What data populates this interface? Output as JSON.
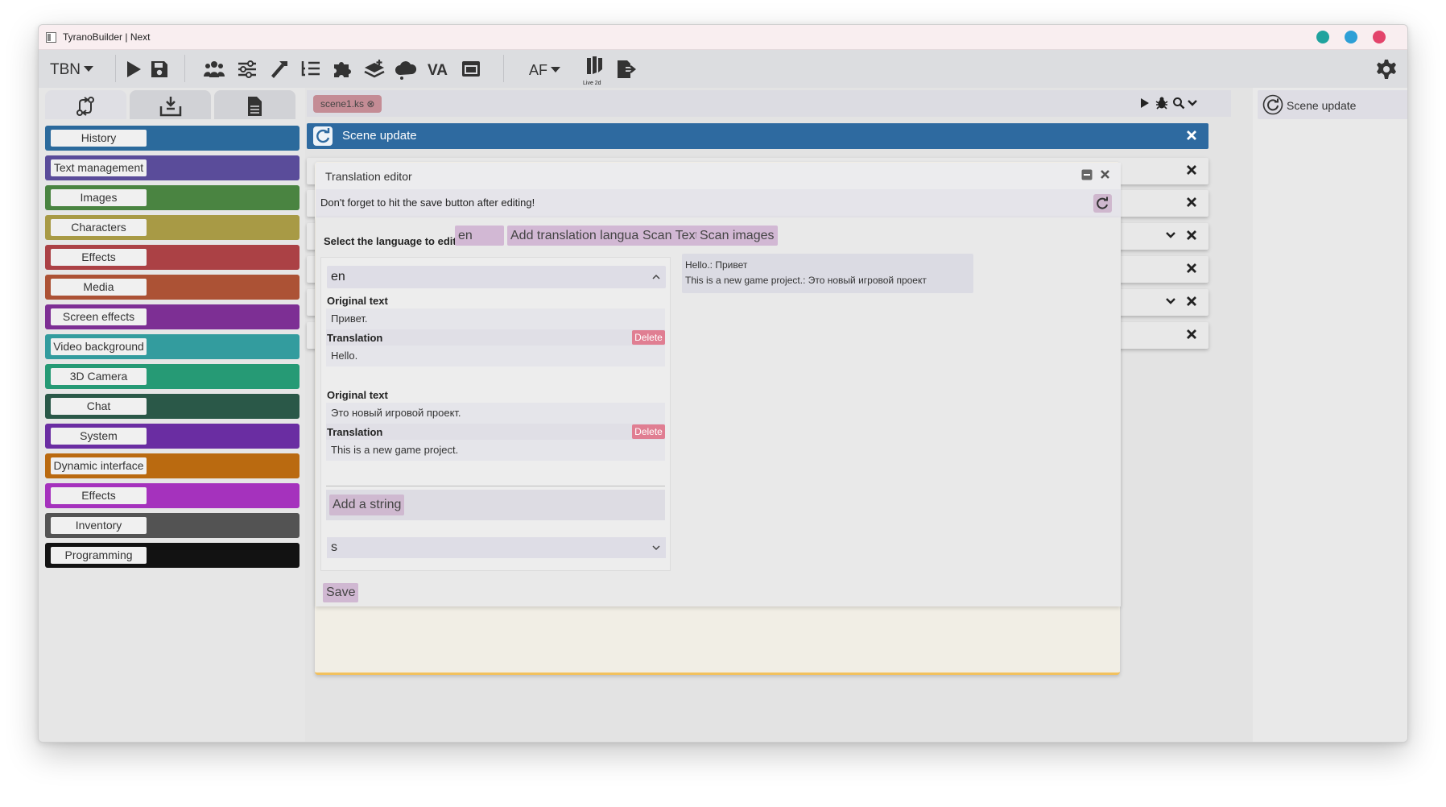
{
  "window": {
    "title": "TyranoBuilder | Next",
    "traffic_colors": [
      "#20a39e",
      "#2e9fd6",
      "#e3446b"
    ]
  },
  "toolbar": {
    "menu_label": "TBN",
    "af_label": "AF",
    "live2d_label": "Live 2d",
    "icons": [
      "play-icon",
      "save-icon",
      "characters-icon",
      "settings-sliders-icon",
      "hammer-icon",
      "list-icon",
      "plugin-icon",
      "layers-icon",
      "cloud-icon",
      "va-icon",
      "window-icon",
      "live2d-icon",
      "export-icon",
      "gear-icon"
    ]
  },
  "palette": {
    "tabs": [
      "scene-flow-icon",
      "import-icon",
      "file-icon"
    ],
    "categories": [
      {
        "label": "History",
        "color": "#2b6a9c"
      },
      {
        "label": "Text management",
        "color": "#5a4c9a"
      },
      {
        "label": "Images",
        "color": "#4a8441"
      },
      {
        "label": "Characters",
        "color": "#a89a45"
      },
      {
        "label": "Effects",
        "color": "#ab4145"
      },
      {
        "label": "Media",
        "color": "#ac5235"
      },
      {
        "label": "Screen effects",
        "color": "#7d2f94"
      },
      {
        "label": "Video background",
        "color": "#339c9e"
      },
      {
        "label": "3D Camera",
        "color": "#269a75"
      },
      {
        "label": "Chat",
        "color": "#2a5848"
      },
      {
        "label": "System",
        "color": "#6a2da2"
      },
      {
        "label": "Dynamic interface",
        "color": "#ba6a10"
      },
      {
        "label": "Effects",
        "color": "#a532bd"
      },
      {
        "label": "Inventory",
        "color": "#535353"
      },
      {
        "label": "Programming",
        "color": "#121212"
      }
    ]
  },
  "editor": {
    "file_tab": "scene1.ks",
    "scene_bar_label": "Scene update"
  },
  "translation_editor": {
    "title": "Translation editor",
    "notice": "Don't forget to hit the save button after editing!",
    "select_language_label": "Select the language to edit:",
    "language_value": "en",
    "add_language_button": "Add translation language",
    "scan_text_button": "Scan Text",
    "scan_images_button": "Scan images",
    "accordion_title": "en",
    "original_label": "Original text",
    "translation_label": "Translation",
    "delete_label": "Delete",
    "entries": [
      {
        "original": "Привет.",
        "translation": "Hello."
      },
      {
        "original": "Это новый игровой проект.",
        "translation": "This is a new game project."
      }
    ],
    "add_string_button": "Add a string",
    "select_value": "s",
    "save_button": "Save",
    "preview_lines": [
      "Hello.: Привет",
      "This is a new game project.: Это новый игровой проект"
    ]
  },
  "right_panel": {
    "item_label": "Scene update"
  }
}
